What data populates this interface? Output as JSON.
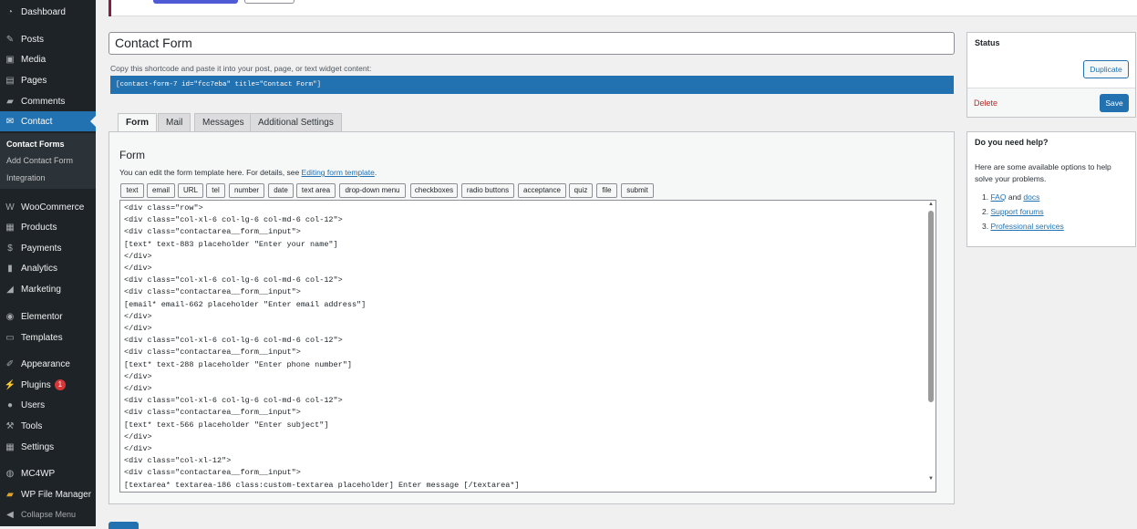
{
  "sidebar": {
    "items": [
      {
        "label": "Dashboard",
        "icon": "dashboard-icon",
        "glyph": "◔"
      },
      {
        "label": "Posts",
        "icon": "pin-icon",
        "glyph": "✎"
      },
      {
        "label": "Media",
        "icon": "media-icon",
        "glyph": "▣"
      },
      {
        "label": "Pages",
        "icon": "pages-icon",
        "glyph": "▤"
      },
      {
        "label": "Comments",
        "icon": "comments-icon",
        "glyph": "▰"
      },
      {
        "label": "Contact",
        "icon": "mail-icon",
        "glyph": "✉"
      },
      {
        "label": "WooCommerce",
        "icon": "woo-icon",
        "glyph": "W"
      },
      {
        "label": "Products",
        "icon": "products-icon",
        "glyph": "▦"
      },
      {
        "label": "Payments",
        "icon": "payments-icon",
        "glyph": "$"
      },
      {
        "label": "Analytics",
        "icon": "analytics-icon",
        "glyph": "▮"
      },
      {
        "label": "Marketing",
        "icon": "megaphone-icon",
        "glyph": "◢"
      },
      {
        "label": "Elementor",
        "icon": "elementor-icon",
        "glyph": "◉"
      },
      {
        "label": "Templates",
        "icon": "folder-icon",
        "glyph": "▭"
      },
      {
        "label": "Appearance",
        "icon": "brush-icon",
        "glyph": "✐"
      },
      {
        "label": "Plugins",
        "icon": "plugin-icon",
        "glyph": "⚡",
        "badge": "1"
      },
      {
        "label": "Users",
        "icon": "users-icon",
        "glyph": "●"
      },
      {
        "label": "Tools",
        "icon": "wrench-icon",
        "glyph": "⚒"
      },
      {
        "label": "Settings",
        "icon": "settings-icon",
        "glyph": "▦"
      },
      {
        "label": "MC4WP",
        "icon": "mc4wp-icon",
        "glyph": "◍"
      },
      {
        "label": "WP File Manager",
        "icon": "file-manager-icon",
        "glyph": "▰"
      },
      {
        "label": "Collapse Menu",
        "icon": "collapse-icon",
        "glyph": "◀"
      }
    ],
    "submenu": [
      "Contact Forms",
      "Add Contact Form",
      "Integration"
    ]
  },
  "form": {
    "title": "Contact Form",
    "shortcode_label": "Copy this shortcode and paste it into your post, page, or text widget content:",
    "shortcode": "[contact-form-7 id=\"fcc7eba\" title=\"Contact Form\"]",
    "tabs": [
      "Form",
      "Mail",
      "Messages",
      "Additional Settings"
    ],
    "panel_heading": "Form",
    "desc_prefix": "You can edit the form template here. For details, see ",
    "desc_link": "Editing form template",
    "desc_suffix": ".",
    "tag_buttons": [
      "text",
      "email",
      "URL",
      "tel",
      "number",
      "date",
      "text area",
      "drop-down menu",
      "checkboxes",
      "radio buttons",
      "acceptance",
      "quiz",
      "file",
      "submit"
    ],
    "code_lines": [
      "<div class=\"row\">",
      "<div class=\"col-xl-6 col-lg-6 col-md-6 col-12\">",
      "<div class=\"contactarea__form__input\">",
      "[text* text-883 placeholder \"Enter your name\"]",
      "</div>",
      "</div>",
      "<div class=\"col-xl-6 col-lg-6 col-md-6 col-12\">",
      "<div class=\"contactarea__form__input\">",
      "[email* email-662 placeholder \"Enter email address\"]",
      "</div>",
      "</div>",
      "<div class=\"col-xl-6 col-lg-6 col-md-6 col-12\">",
      "<div class=\"contactarea__form__input\">",
      "[text* text-288 placeholder \"Enter phone number\"]",
      "</div>",
      "</div>",
      "<div class=\"col-xl-6 col-lg-6 col-md-6 col-12\">",
      "<div class=\"contactarea__form__input\">",
      "[text* text-566 placeholder \"Enter subject\"]",
      "</div>",
      "</div>",
      "<div class=\"col-xl-12\">",
      "<div class=\"contactarea__form__input\">",
      "[textarea* textarea-186 class:custom-textarea placeholder] Enter message [/textarea*]"
    ]
  },
  "status": {
    "title": "Status",
    "duplicate_label": "Duplicate",
    "delete_label": "Delete",
    "save_label": "Save"
  },
  "help": {
    "title": "Do you need help?",
    "intro": "Here are some available options to help solve your problems.",
    "faq": "FAQ",
    "and": "and",
    "docs": "docs",
    "support": "Support forums",
    "professional": "Professional services"
  },
  "colors": {
    "accent": "#2271b1",
    "sidebar_bg": "#1d2327",
    "delete": "#b32d2e"
  }
}
